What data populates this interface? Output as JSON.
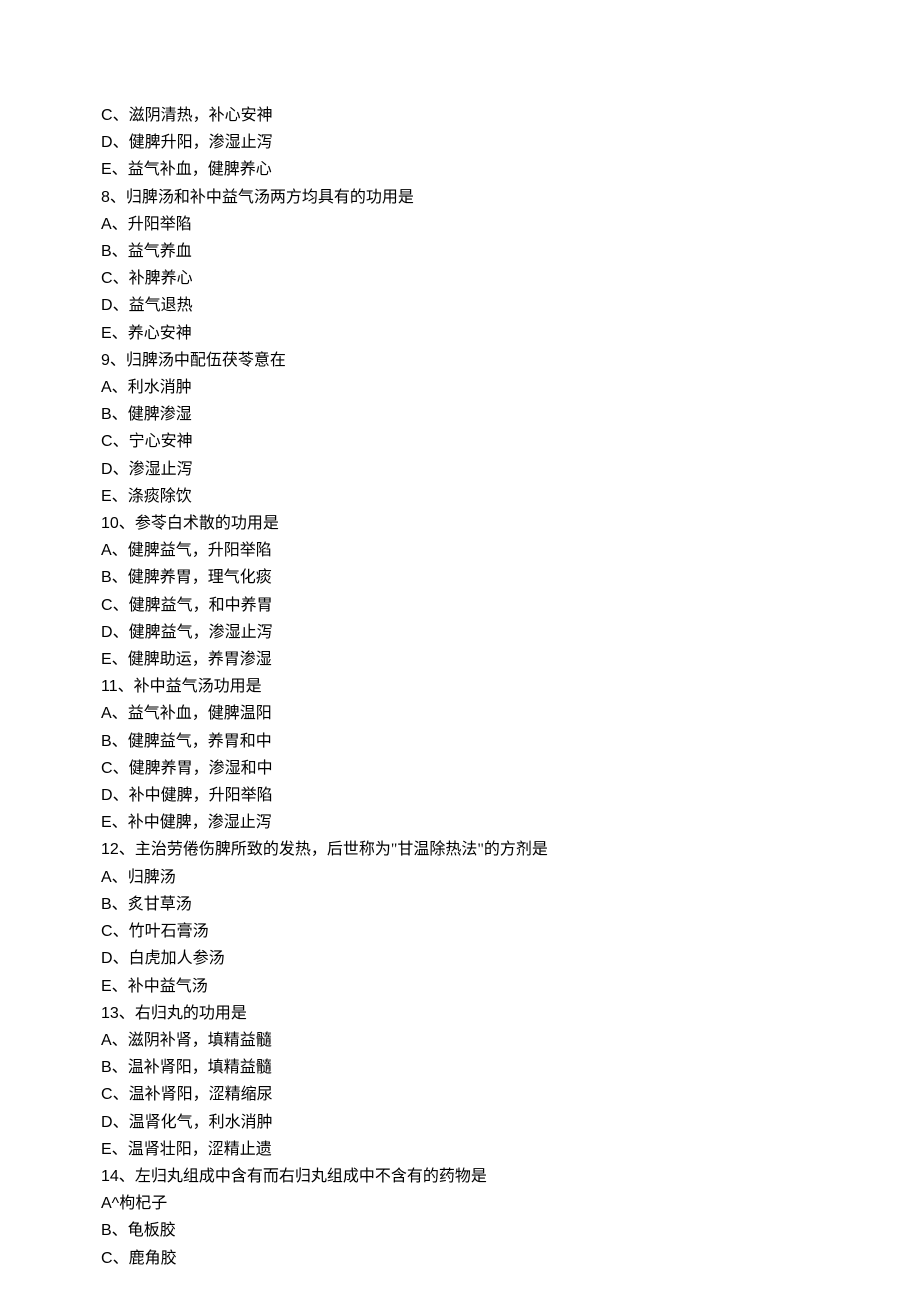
{
  "lines": [
    {
      "label": "C",
      "sep": "、",
      "text": "滋阴清热，补心安神"
    },
    {
      "label": "D",
      "sep": "、",
      "text": "健脾升阳，渗湿止泻"
    },
    {
      "label": "E",
      "sep": "、",
      "text": "益气补血，健脾养心"
    },
    {
      "label": "8",
      "sep": "、",
      "text": "归脾汤和补中益气汤两方均具有的功用是"
    },
    {
      "label": "A",
      "sep": "、",
      "text": "升阳举陷"
    },
    {
      "label": "B",
      "sep": "、",
      "text": "益气养血"
    },
    {
      "label": "C",
      "sep": "、",
      "text": "补脾养心"
    },
    {
      "label": "D",
      "sep": "、",
      "text": "益气退热"
    },
    {
      "label": "E",
      "sep": "、",
      "text": "养心安神"
    },
    {
      "label": "9",
      "sep": "、",
      "text": "归脾汤中配伍茯苓意在"
    },
    {
      "label": "A",
      "sep": "、",
      "text": "利水消肿"
    },
    {
      "label": "B",
      "sep": "、",
      "text": "健脾渗湿"
    },
    {
      "label": "C",
      "sep": "、",
      "text": "宁心安神"
    },
    {
      "label": "D",
      "sep": "、",
      "text": "渗湿止泻"
    },
    {
      "label": "E",
      "sep": "、",
      "text": "涤痰除饮"
    },
    {
      "label": "10",
      "sep": "、",
      "text": "参苓白术散的功用是"
    },
    {
      "label": "A",
      "sep": "、",
      "text": "健脾益气，升阳举陷"
    },
    {
      "label": "B",
      "sep": "、",
      "text": "健脾养胃，理气化痰"
    },
    {
      "label": "C",
      "sep": "、",
      "text": "健脾益气，和中养胃"
    },
    {
      "label": "D",
      "sep": "、",
      "text": "健脾益气，渗湿止泻"
    },
    {
      "label": "E",
      "sep": "、",
      "text": "健脾助运，养胃渗湿"
    },
    {
      "label": "11",
      "sep": "、",
      "text": "补中益气汤功用是"
    },
    {
      "label": "A",
      "sep": "、",
      "text": "益气补血，健脾温阳"
    },
    {
      "label": "B",
      "sep": "、",
      "text": "健脾益气，养胃和中"
    },
    {
      "label": "C",
      "sep": "、",
      "text": "健脾养胃，渗湿和中"
    },
    {
      "label": "D",
      "sep": "、",
      "text": "补中健脾，升阳举陷"
    },
    {
      "label": "E",
      "sep": "、",
      "text": "补中健脾，渗湿止泻"
    },
    {
      "label": "12",
      "sep": "、",
      "text": "主治劳倦伤脾所致的发热，后世称为\"甘温除热法\"的方剂是"
    },
    {
      "label": "A",
      "sep": "、",
      "text": "归脾汤"
    },
    {
      "label": "B",
      "sep": "、",
      "text": "炙甘草汤"
    },
    {
      "label": "C",
      "sep": "、",
      "text": "竹叶石膏汤"
    },
    {
      "label": "D",
      "sep": "、",
      "text": "白虎加人参汤"
    },
    {
      "label": "E",
      "sep": "、",
      "text": "补中益气汤"
    },
    {
      "label": "13",
      "sep": "、",
      "text": "右归丸的功用是"
    },
    {
      "label": "A",
      "sep": "、",
      "text": "滋阴补肾，填精益髓"
    },
    {
      "label": "B",
      "sep": "、",
      "text": "温补肾阳，填精益髓"
    },
    {
      "label": "C",
      "sep": "、",
      "text": "温补肾阳，涩精缩尿"
    },
    {
      "label": "D",
      "sep": "、",
      "text": "温肾化气，利水消肿"
    },
    {
      "label": "E",
      "sep": "、",
      "text": "温肾壮阳，涩精止遗"
    },
    {
      "label": "14",
      "sep": "、",
      "text": "左归丸组成中含有而右归丸组成中不含有的药物是"
    },
    {
      "label": "A^",
      "sep": "",
      "text": "枸杞子"
    },
    {
      "label": "B",
      "sep": "、",
      "text": "龟板胶"
    },
    {
      "label": "C",
      "sep": "、",
      "text": "鹿角胶"
    }
  ]
}
